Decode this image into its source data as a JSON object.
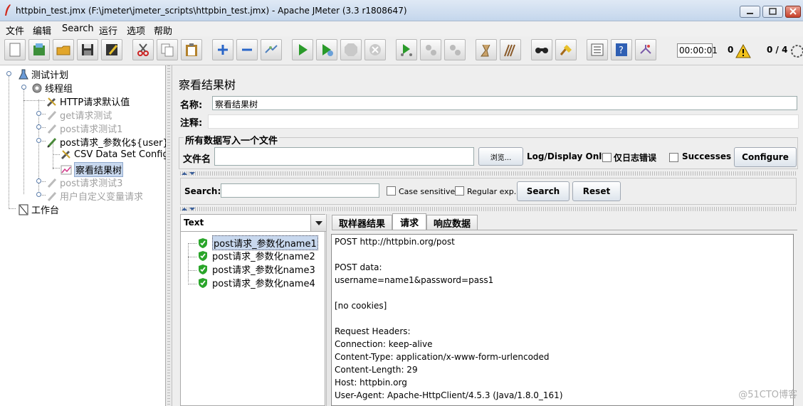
{
  "window": {
    "title": "httpbin_test.jmx (F:\\jmeter\\jmeter_scripts\\httpbin_test.jmx) - Apache JMeter (3.3 r1808647)"
  },
  "menu": [
    "文件",
    "编辑",
    "Search",
    "运行",
    "选项",
    "帮助"
  ],
  "toolbar": {
    "buttons": [
      "new-icon",
      "templates-icon",
      "open-icon",
      "save-icon",
      "save-as-icon",
      "cut-icon",
      "copy-icon",
      "paste-icon",
      "expand-icon",
      "collapse-icon",
      "toggle-icon",
      "start-icon",
      "start-no-pause-icon",
      "stop-icon",
      "shutdown-icon",
      "remote-start-icon",
      "remote-stop-icon",
      "remote-shutdown-icon",
      "clear-icon",
      "clear-all-icon",
      "search-icon",
      "reset-search-icon",
      "function-helper-icon",
      "help-icon",
      "log-icon"
    ],
    "timer": "00:00:01",
    "error_count": "0",
    "threads": "0 / 4"
  },
  "tree": {
    "root": "测试计划",
    "thread_group": "线程组",
    "items": [
      {
        "label": "HTTP请求默认值",
        "disabled": false
      },
      {
        "label": "get请求测试",
        "disabled": true
      },
      {
        "label": "post请求测试1",
        "disabled": true
      },
      {
        "label": "post请求_参数化${user}",
        "disabled": false
      },
      {
        "label": "CSV Data Set Config",
        "disabled": false
      },
      {
        "label": "察看结果树",
        "disabled": false,
        "selected": true
      },
      {
        "label": "post请求测试3",
        "disabled": true
      },
      {
        "label": "用户自定义变量请求",
        "disabled": true
      }
    ],
    "workbench": "工作台"
  },
  "panel": {
    "title": "察看结果树",
    "name_label": "名称:",
    "name_value": "察看结果树",
    "comment_label": "注释:",
    "comment_value": "",
    "file_group_title": "所有数据写入一个文件",
    "filename_label": "文件名",
    "filename_value": "",
    "browse_label": "浏览...",
    "log_display_only": "Log/Display Only:",
    "errors_only": "仅日志错误",
    "successes": "Successes",
    "configure": "Configure"
  },
  "search": {
    "label": "Search:",
    "value": "",
    "case_sensitive": "Case sensitive",
    "regular_exp": "Regular exp.",
    "search_button": "Search",
    "reset_button": "Reset"
  },
  "results": {
    "renderer": "Text",
    "samples": [
      "post请求_参数化name1",
      "post请求_参数化name2",
      "post请求_参数化name3",
      "post请求_参数化name4"
    ],
    "selected_index": 0
  },
  "tabs": [
    "取样器结果",
    "请求",
    "响应数据"
  ],
  "active_tab": 1,
  "request_lines": [
    "POST http://httpbin.org/post",
    "",
    "POST data:",
    "username=name1&password=pass1",
    "",
    "[no cookies]",
    "",
    "Request Headers:",
    "Connection: keep-alive",
    "Content-Type: application/x-www-form-urlencoded",
    "Content-Length: 29",
    "Host: httpbin.org",
    "User-Agent: Apache-HttpClient/4.5.3 (Java/1.8.0_161)"
  ],
  "watermark": "@51CTO博客"
}
